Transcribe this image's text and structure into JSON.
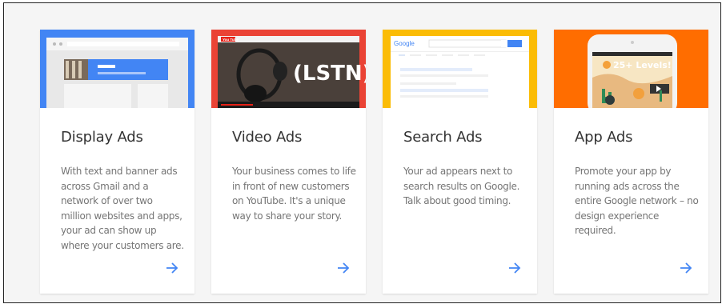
{
  "cards": [
    {
      "title": "Display Ads",
      "description": "With text and banner ads across Gmail and a network of over two million websites and apps, your ad can show up where your customers are.",
      "accent": "#4285f4"
    },
    {
      "title": "Video Ads",
      "description": "Your business comes to life in front of new customers on YouTube. It's a unique way to share your story.",
      "accent": "#ea4335",
      "hero_text": "(LSTN)",
      "hero_brand": "You Tube"
    },
    {
      "title": "Search Ads",
      "description": "Your ad appears next to search results on Google. Talk about good timing.",
      "accent": "#fbbc05",
      "hero_text": "Google"
    },
    {
      "title": "App Ads",
      "description": "Promote your app by running ads across the entire Google network – no design experience required.",
      "accent": "#ff6d00",
      "hero_text": "25+ Levels!"
    }
  ],
  "arrow_icon": "arrow-right-icon",
  "link_color": "#4285f4"
}
